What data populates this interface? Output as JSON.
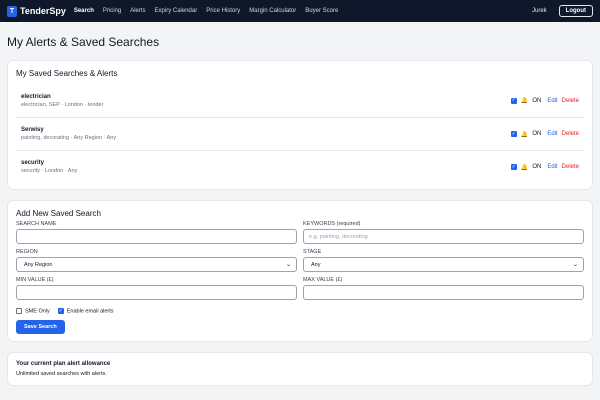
{
  "nav": {
    "logo_letter": "T",
    "brand": "TenderSpy",
    "links": [
      {
        "label": "Search",
        "active": true
      },
      {
        "label": "Pricing"
      },
      {
        "label": "Alerts"
      },
      {
        "label": "Expiry Calendar"
      },
      {
        "label": "Price History"
      },
      {
        "label": "Margin Calculator"
      },
      {
        "label": "Buyer Score"
      }
    ],
    "username": "Jurek",
    "logout": "Logout"
  },
  "page_title": "My Alerts & Saved Searches",
  "saved": {
    "heading": "My Saved Searches & Alerts",
    "items": [
      {
        "name": "electrician",
        "desc": "electrician, SEP · London · tender",
        "status": "ON",
        "edit": "Edit",
        "delete": "Delete"
      },
      {
        "name": "Serwisy",
        "desc": "painting, decorating · Any Region · Any",
        "status": "ON",
        "edit": "Edit",
        "delete": "Delete"
      },
      {
        "name": "security",
        "desc": "security · London · Any",
        "status": "ON",
        "edit": "Edit",
        "delete": "Delete"
      }
    ]
  },
  "form": {
    "heading": "Add New Saved Search",
    "search_name_label": "SEARCH NAME",
    "search_name_value": "",
    "keywords_label": "KEYWORDS (required)",
    "keywords_placeholder": "e.g. painting, decorating",
    "region_label": "REGION",
    "region_value": "Any Region",
    "stage_label": "STAGE",
    "stage_value": "Any",
    "min_label": "MIN VALUE (£)",
    "max_label": "MAX VALUE (£)",
    "sme_label": "SME Only",
    "email_label": "Enable email alerts",
    "save_label": "Save Search"
  },
  "plan": {
    "title": "Your current plan alert allowance",
    "text": "Unlimited saved searches with alerts."
  },
  "colors": {
    "nav_bg": "#0f172a",
    "accent": "#2563eb",
    "danger": "#dc2626"
  }
}
